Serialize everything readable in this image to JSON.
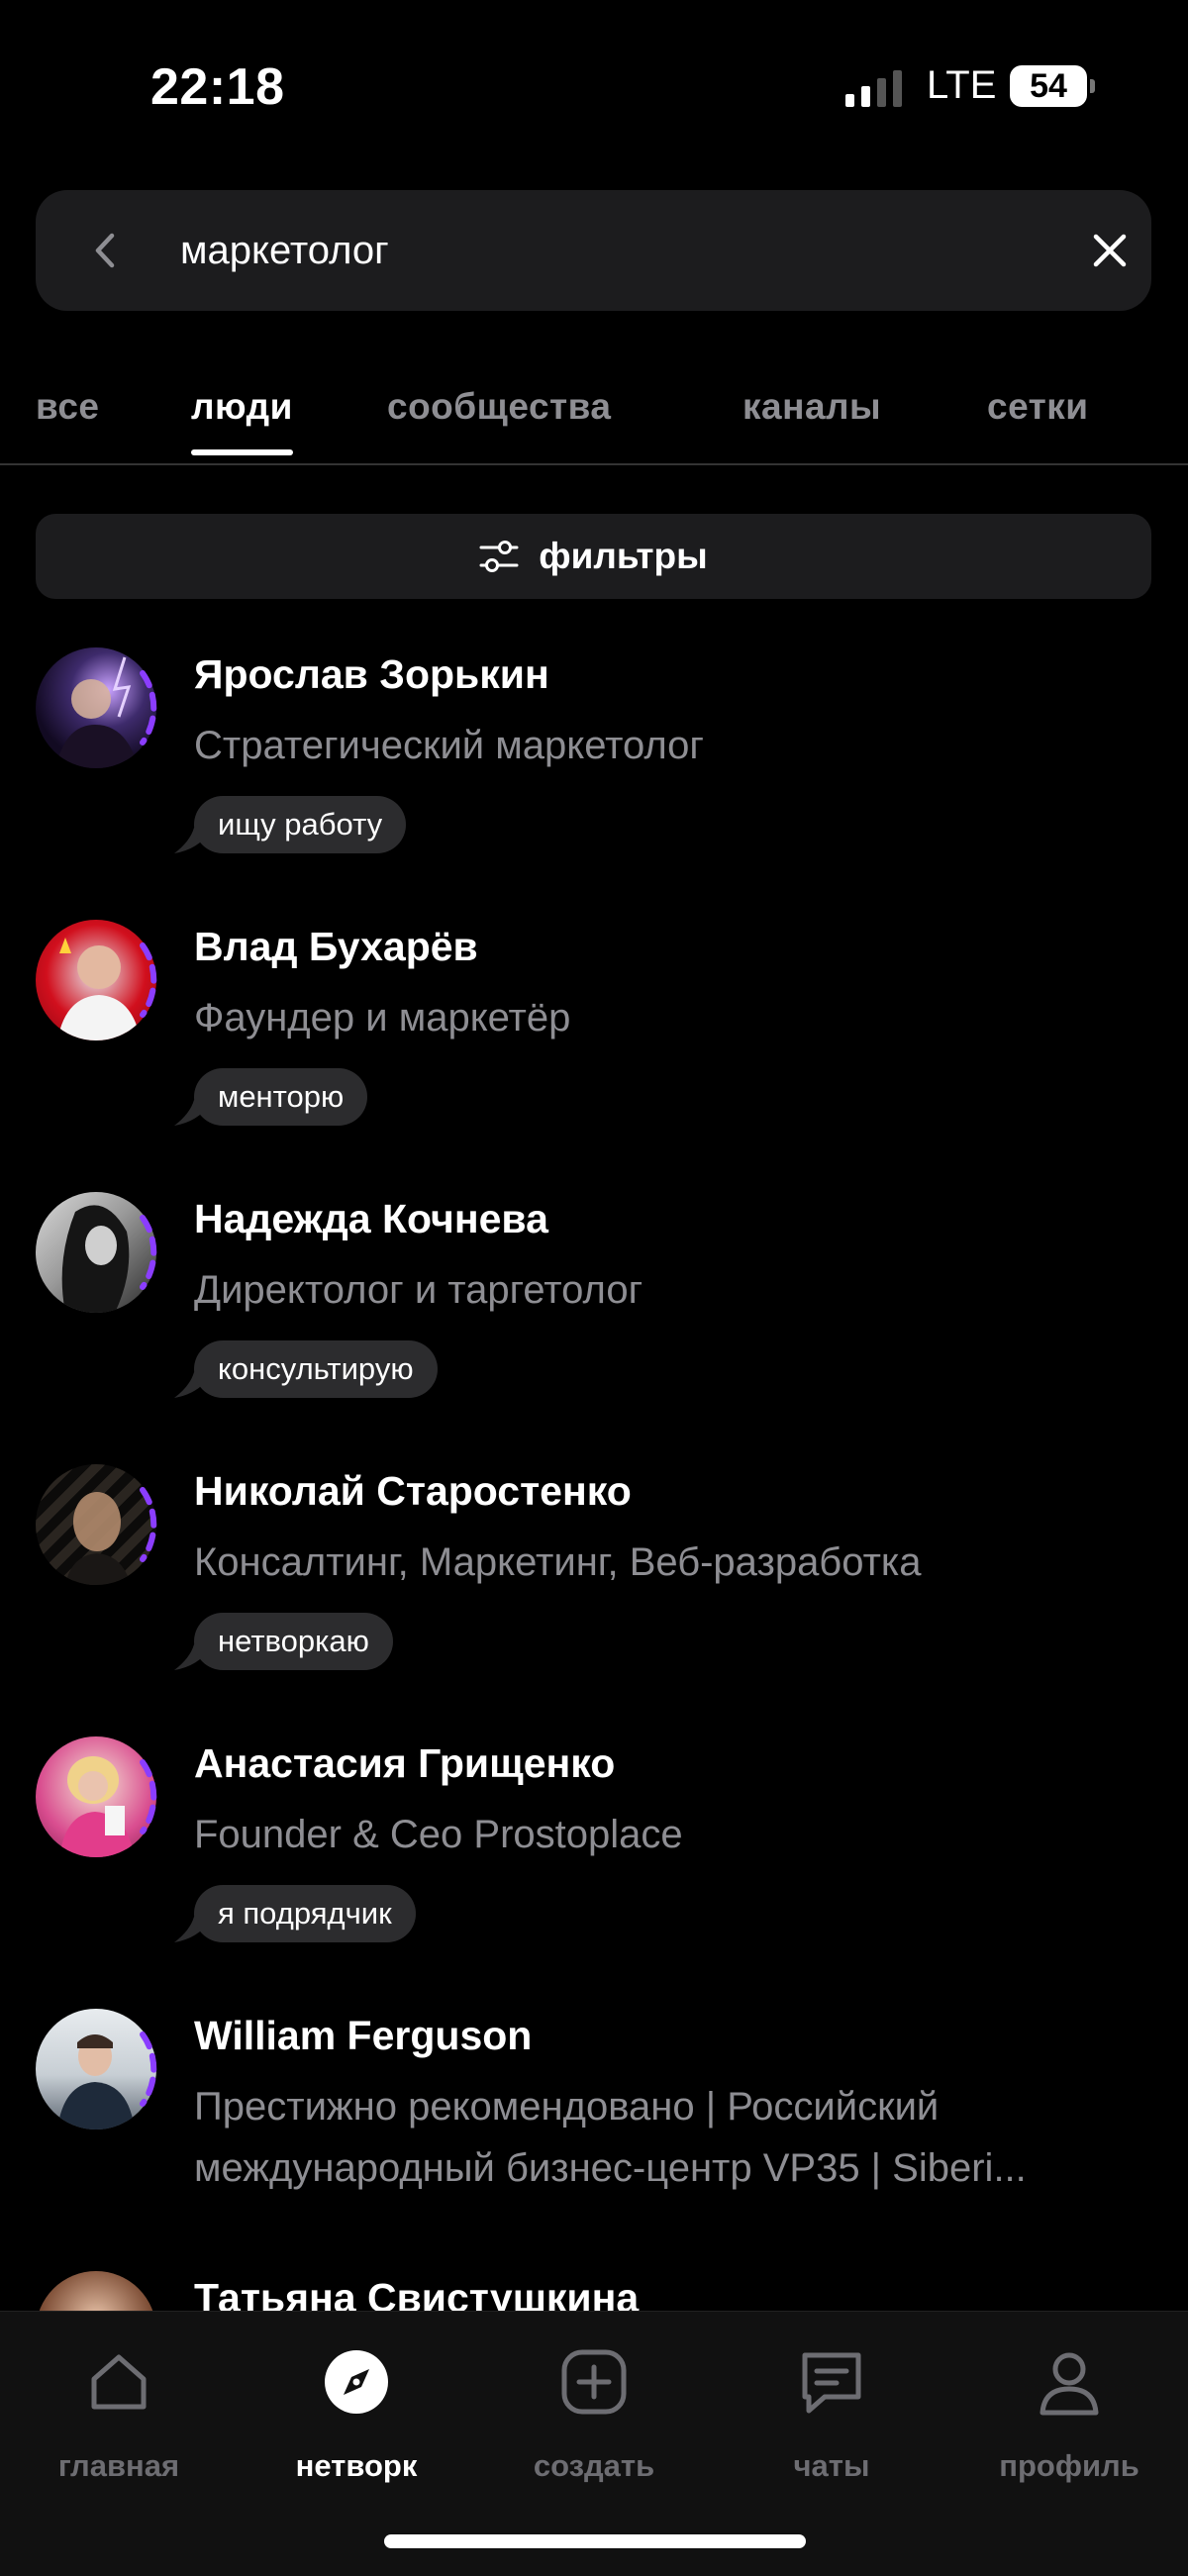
{
  "status": {
    "time": "22:18",
    "network": "LTE",
    "battery": "54"
  },
  "search": {
    "query": "маркетолог",
    "placeholder": ""
  },
  "tabs": [
    {
      "label": "все",
      "active": false
    },
    {
      "label": "люди",
      "active": true
    },
    {
      "label": "сообщества",
      "active": false
    },
    {
      "label": "каналы",
      "active": false
    },
    {
      "label": "сетки",
      "active": false
    }
  ],
  "filters": {
    "label": "фильтры"
  },
  "people": [
    {
      "name": "Ярослав Зорькин",
      "title": "Стратегический маркетолог",
      "badge": "ищу работу"
    },
    {
      "name": "Влад Бухарёв",
      "title": "Фаундер и маркетёр",
      "badge": "менторю"
    },
    {
      "name": "Надежда Кочнева",
      "title": "Директолог и таргетолог",
      "badge": "консультирую"
    },
    {
      "name": "Николай Старостенко",
      "title": "Консалтинг, Маркетинг, Веб-разработка",
      "badge": "нетворкаю"
    },
    {
      "name": "Анастасия Грищенко",
      "title": "Founder & Ceo Prostoplace",
      "badge": "я подрядчик"
    },
    {
      "name": "William Ferguson",
      "title": "Престижно рекомендовано | Российский международный бизнес-центр VP35 | Siberi...",
      "badge": ""
    },
    {
      "name": "Татьяна Свистушкина",
      "title": "",
      "badge": ""
    }
  ],
  "nav": [
    {
      "label": "главная",
      "icon": "home-icon",
      "active": false
    },
    {
      "label": "нетворк",
      "icon": "compass-icon",
      "active": true
    },
    {
      "label": "создать",
      "icon": "plus-square-icon",
      "active": false
    },
    {
      "label": "чаты",
      "icon": "chat-icon",
      "active": false
    },
    {
      "label": "профиль",
      "icon": "profile-icon",
      "active": false
    }
  ],
  "colors": {
    "accent_ring": "#8b3dff",
    "surface": "#1c1c1e",
    "muted_text": "#8e8e93"
  }
}
